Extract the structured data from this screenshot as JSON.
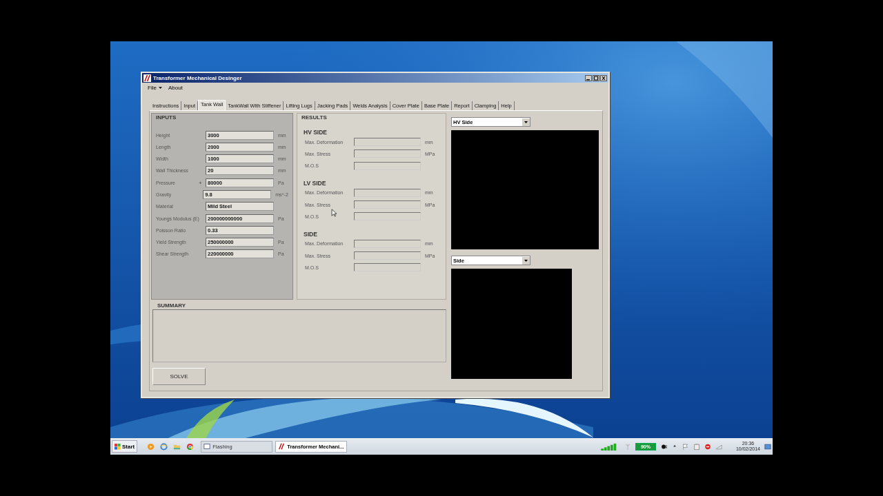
{
  "window": {
    "title": "Transformer Mechanical Desinger"
  },
  "menu": [
    {
      "label": "File",
      "kind": "dropdown"
    },
    {
      "label": "About",
      "kind": "plain"
    }
  ],
  "tabs": [
    {
      "label": "Instructions",
      "selected": false
    },
    {
      "label": "Input",
      "selected": false
    },
    {
      "label": "Tank Wall",
      "selected": true
    },
    {
      "label": "TankWall With Stiffener",
      "selected": false
    },
    {
      "label": "Lifting Lugs",
      "selected": false
    },
    {
      "label": "Jacking Pads",
      "selected": false
    },
    {
      "label": "Welds Analysis",
      "selected": false
    },
    {
      "label": "Cover Plate",
      "selected": false
    },
    {
      "label": "Base Plate",
      "selected": false
    },
    {
      "label": "Report",
      "selected": false
    },
    {
      "label": "Clamping",
      "selected": false
    },
    {
      "label": "Help",
      "selected": false
    }
  ],
  "inputs": {
    "title": "INPUTS",
    "rows": [
      {
        "label": "Height",
        "value": "3000",
        "unit": "mm"
      },
      {
        "label": "Length",
        "value": "2000",
        "unit": "mm"
      },
      {
        "label": "Width",
        "value": "1000",
        "unit": "mm"
      },
      {
        "label": "Wall Thickness",
        "value": "20",
        "unit": "mm"
      },
      {
        "label": "Pressure",
        "marker": "+",
        "value": "80000",
        "unit": "Pa"
      },
      {
        "label": "Gravity",
        "value": "9.8",
        "unit": "ms^-2"
      },
      {
        "label": "Material",
        "value": "Mild Steel"
      },
      {
        "label": "Youngs Modulus (E)",
        "value": "200000000000",
        "unit": "Pa"
      },
      {
        "label": "Poisson Ratio",
        "value": "0.33"
      },
      {
        "label": "Yield Strength",
        "value": "250000000",
        "unit": "Pa"
      },
      {
        "label": "Shear Strength",
        "value": "220000000",
        "unit": "Pa"
      }
    ]
  },
  "results": {
    "title": "RESULTS",
    "groups": [
      {
        "heading": "HV SIDE",
        "rows": [
          {
            "label": "Max. Deformation",
            "unit": "mm"
          },
          {
            "label": "Max. Stress",
            "unit": "MPa"
          },
          {
            "label": "M.O.S"
          }
        ]
      },
      {
        "heading": "LV SIDE",
        "rows": [
          {
            "label": "Max. Deformation",
            "unit": "mm"
          },
          {
            "label": "Max. Stress",
            "unit": "MPa"
          },
          {
            "label": "M.O.S"
          }
        ]
      },
      {
        "heading": "SIDE",
        "rows": [
          {
            "label": "Max. Deformation",
            "unit": "mm"
          },
          {
            "label": "Max. Stress",
            "unit": "MPa"
          },
          {
            "label": "M.O.S"
          }
        ]
      }
    ]
  },
  "summary": {
    "title": "SUMMARY"
  },
  "solve_button": "SOLVE",
  "views": [
    {
      "option": "HV Side",
      "kind": "wide"
    },
    {
      "option": "Side",
      "kind": "narrow"
    }
  ],
  "taskbar": {
    "start": "Start",
    "tasks": [
      {
        "label": "Flashing",
        "selected": false
      },
      {
        "label": "Transformer Mechani...",
        "selected": true
      }
    ],
    "battery": "90%",
    "time": "20:36",
    "date": "10/02/2014"
  }
}
